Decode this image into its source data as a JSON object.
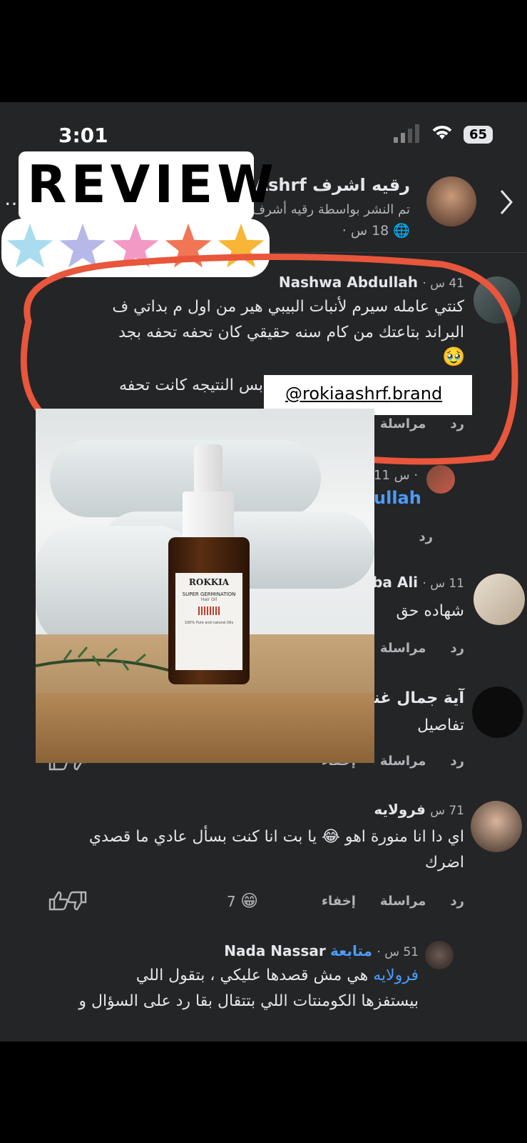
{
  "status": {
    "time": "3:01",
    "battery": "65"
  },
  "post": {
    "author": "رقيه اشرف Rokia Ashrf",
    "subtitle": "تم النشر بواسطة رقيه أشرف",
    "time": "18 س ·"
  },
  "overlay": {
    "review_text": "REVIEW",
    "handle": "@rokiaashrf.brand",
    "star_colors": [
      "#a9dcef",
      "#b6b8e8",
      "#f29ac6",
      "#f07656",
      "#f7b635"
    ]
  },
  "comments": [
    {
      "name": "Nashwa Abdullah",
      "time": "41 س ·",
      "text1": "كنتي عامله سيرم لأنبات البيبي هير من اول م بداتي ف",
      "text2": "البراند بتاعتك من كام سنه حقيقي كان تحفه تحفه بجد",
      "emoji": "🥹",
      "text3": "بس النتيجه كانت تحفه",
      "reply": "رد",
      "message": "مراسلة"
    },
    {
      "name": "ullah",
      "time": "11 س ·",
      "reply": "رد"
    },
    {
      "name": "ba Ali",
      "time": "11 س ·",
      "text1": "شهاده حق",
      "reply": "رد",
      "message": "مراسلة"
    },
    {
      "name": "آية جمال غنيم",
      "text1": "تفاصيل",
      "reply": "رد",
      "message": "مراسلة",
      "hide": "إخفاء"
    },
    {
      "name": "فرولايه",
      "time": "71 س",
      "text1": "اي دا انا منورة اهو 😂 يا بت انا كنت بسأل عادي ما قصدي",
      "text2": "اضرك",
      "reply": "رد",
      "message": "مراسلة",
      "hide": "إخفاء",
      "reaction_count": "7"
    },
    {
      "name": "Nada Nassar",
      "follow": "متابعة",
      "time": "51 س ·",
      "mention": "فرولايه",
      "text1": "هي مش قصدها عليكي ، بتقول اللي",
      "text2": "بيستفزها الكومنتات اللي بتتقال بقا رد على السؤال و"
    }
  ],
  "product": {
    "brand": "ROKKIA",
    "line1": "SUPER GERMINATION",
    "line2": "Hair Oil",
    "line3": "100% Pure and natural Oils"
  }
}
